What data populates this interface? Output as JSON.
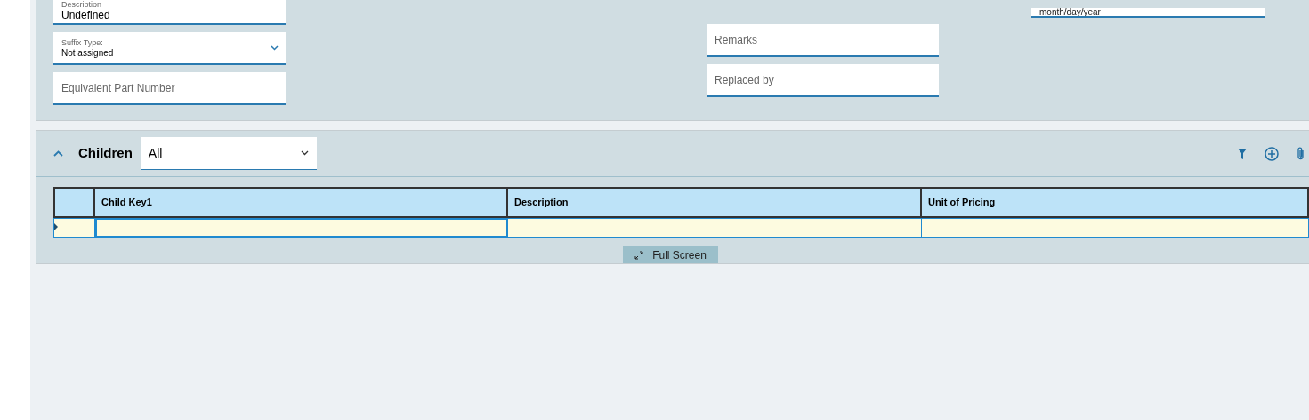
{
  "form": {
    "description": {
      "label": "Description",
      "value": "Undefined"
    },
    "suffix_type": {
      "label": "Suffix Type:",
      "value": "Not assigned"
    },
    "equivalent_part_number": {
      "placeholder": "Equivalent Part Number"
    },
    "remarks": {
      "placeholder": "Remarks"
    },
    "replaced_by": {
      "placeholder": "Replaced by"
    },
    "date": {
      "placeholder": "month/day/year"
    }
  },
  "children": {
    "title": "Children",
    "expanded": true,
    "filter": "All",
    "table": {
      "columns": [
        "Child Key1",
        "Description",
        "Unit of Pricing"
      ],
      "rows": [
        {
          "selected": true
        }
      ]
    },
    "full_screen": "Full Screen"
  }
}
